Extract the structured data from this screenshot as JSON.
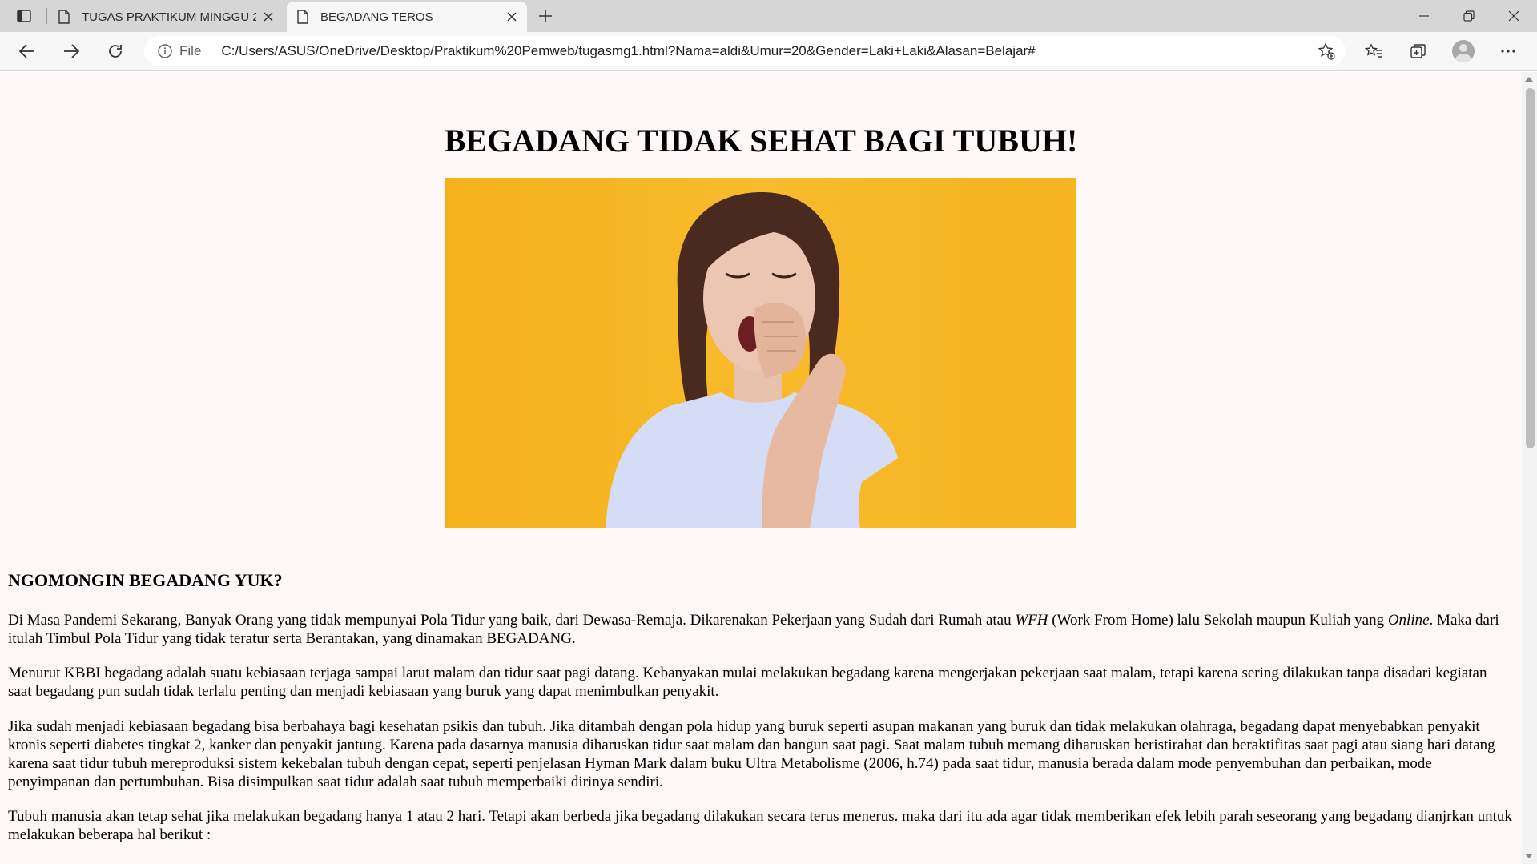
{
  "browser": {
    "tabs": [
      {
        "title": "TUGAS PRAKTIKUM MINGGU 2",
        "active": false
      },
      {
        "title": "BEGADANG TEROS",
        "active": true
      }
    ],
    "address": {
      "scheme_label": "File",
      "url": "C:/Users/ASUS/OneDrive/Desktop/Praktikum%20Pemweb/tugasmg1.html?Nama=aldi&Umur=20&Gender=Laki+Laki&Alasan=Belajar#"
    },
    "icons": {
      "tab_actions": "tab-actions-icon",
      "page": "page-icon",
      "close": "close-icon",
      "new_tab": "plus-icon",
      "minimize": "minimize-icon",
      "restore": "restore-icon",
      "window_close": "close-icon",
      "back": "arrow-left-icon",
      "forward": "arrow-right-icon",
      "refresh": "refresh-icon",
      "info": "info-icon",
      "add_favorite": "star-plus-icon",
      "favorites": "favorites-icon",
      "collections": "collections-icon",
      "profile": "avatar-icon",
      "more": "ellipsis-icon"
    }
  },
  "page": {
    "heading": "BEGADANG TIDAK SEHAT BAGI TUBUH!",
    "section_title": "NGOMONGIN BEGADANG YUK?",
    "p1": {
      "a": "Di Masa Pandemi Sekarang, Banyak Orang yang tidak mempunyai Pola Tidur yang baik, dari Dewasa-Remaja. Dikarenakan Pekerjaan yang Sudah dari Rumah atau ",
      "wfh": "WFH",
      "b": " (Work From Home) lalu Sekolah maupun Kuliah yang ",
      "online": "Online",
      "c": ". Maka dari itulah Timbul Pola Tidur yang tidak teratur serta Berantakan, yang dinamakan BEGADANG."
    },
    "p2": "Menurut KBBI begadang adalah suatu kebiasaan terjaga sampai larut malam dan tidur saat pagi datang. Kebanyakan mulai melakukan begadang karena mengerjakan pekerjaan saat malam, tetapi karena sering dilakukan tanpa disadari kegiatan saat begadang pun sudah tidak terlalu penting dan menjadi kebiasaan yang buruk yang dapat menimbulkan penyakit.",
    "p3": "Jika sudah menjadi kebiasaan begadang bisa berbahaya bagi kesehatan psikis dan tubuh. Jika ditambah dengan pola hidup yang buruk seperti asupan makanan yang buruk dan tidak melakukan olahraga, begadang dapat menyebabkan penyakit kronis seperti diabetes tingkat 2, kanker dan penyakit jantung. Karena pada dasarnya manusia diharuskan tidur saat malam dan bangun saat pagi. Saat malam tubuh memang diharuskan beristirahat dan beraktifitas saat pagi atau siang hari datang karena saat tidur tubuh mereproduksi sistem kekebalan tubuh dengan cepat, seperti penjelasan Hyman Mark dalam buku Ultra Metabolisme (2006, h.74) pada saat tidur, manusia berada dalam mode penyembuhan dan perbaikan, mode penyimpanan dan pertumbuhan. Bisa disimpulkan saat tidur adalah saat tubuh memperbaiki dirinya sendiri.",
    "p4": "Tubuh manusia akan tetap sehat jika melakukan begadang hanya 1 atau 2 hari. Tetapi akan berbeda jika begadang dilakukan secara terus menerus. maka dari itu ada agar tidak memberikan efek lebih parah seseorang yang begadang dianjrkan untuk melakukan beberapa hal berikut :"
  },
  "colors": {
    "page_bg": "#fdf8f7",
    "hero_bg": "#f8bb2c",
    "tabstrip": "#d6d6d6",
    "toolbar": "#f7f7f7"
  }
}
